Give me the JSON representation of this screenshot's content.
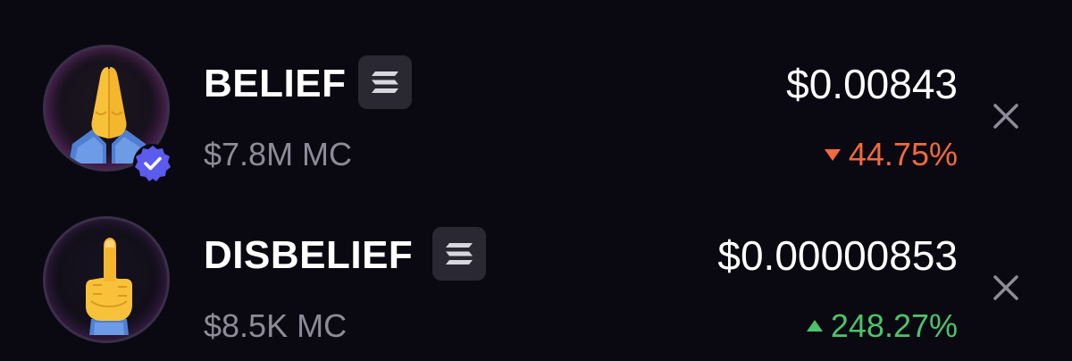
{
  "colors": {
    "background": "#0a0912",
    "primary_text": "#ffffff",
    "secondary_text": "#8e8b98",
    "negative": "#f26a3d",
    "positive": "#4cc36b",
    "badge_bg": "#2a2933",
    "verified": "#5b5bf0"
  },
  "tokens": [
    {
      "name": "BELIEF",
      "avatar_icon": "folded-hands-icon",
      "verified": true,
      "chain_icon": "solana-icon",
      "market_cap": "$7.8M MC",
      "price": "$0.00843",
      "change": "44.75%",
      "change_direction": "down",
      "remove_icon": "close-icon"
    },
    {
      "name": "DISBELIEF",
      "avatar_icon": "middle-finger-icon",
      "verified": false,
      "chain_icon": "solana-icon",
      "market_cap": "$8.5K MC",
      "price": "$0.00000853",
      "change": "248.27%",
      "change_direction": "up",
      "remove_icon": "close-icon"
    }
  ]
}
